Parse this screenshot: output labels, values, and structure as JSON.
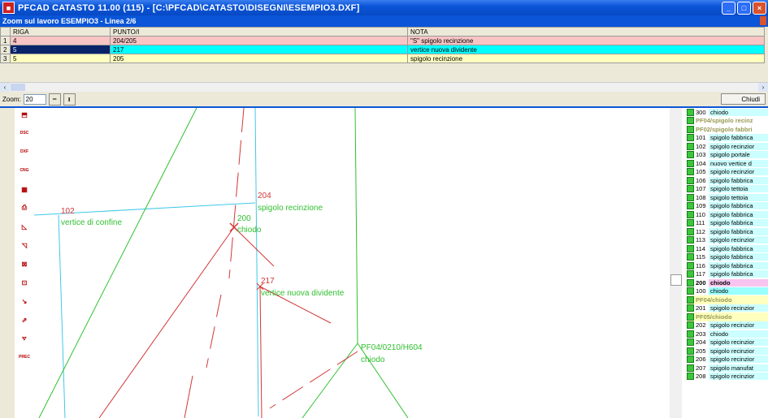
{
  "window": {
    "title": "PFCAD CATASTO 11.00 (115) - [C:\\PFCAD\\CATASTO\\DISEGNI\\ESEMPIO3.DXF]",
    "app_icon": "pfcad-icon",
    "controls": {
      "minimize": "_",
      "maximize": "□",
      "close": "×"
    }
  },
  "zoom_panel": {
    "title": "Zoom sul lavoro ESEMPIO3 - Linea 2/6",
    "columns": [
      "RIGA",
      "PUNTO/I",
      "NOTA"
    ],
    "rows": [
      {
        "num": "1",
        "riga": "4",
        "punto": "204/205",
        "nota": "\"S\" spigolo recinzione",
        "color": "#f8c4c4"
      },
      {
        "num": "2",
        "riga": "5",
        "punto": "217",
        "nota": "vertice nuova dividente",
        "color": "#00ffff"
      },
      {
        "num": "3",
        "riga": "5",
        "punto": "205",
        "nota": "spigolo recinzione",
        "color": "#ffffc0"
      }
    ],
    "zoom_label": "Zoom:",
    "zoom_value": "20",
    "minus_label": "−",
    "plus_label": "ı",
    "close_label": "Chiudi"
  },
  "toolbar": {
    "tools": [
      {
        "name": "tool-icon-1",
        "glyph": "⬒"
      },
      {
        "name": "tool-icon-dsc",
        "glyph": "DSC"
      },
      {
        "name": "tool-icon-dxf",
        "glyph": "DXF"
      },
      {
        "name": "tool-icon-cng",
        "glyph": "CNG"
      },
      {
        "name": "tool-icon-grid",
        "glyph": "▦"
      },
      {
        "name": "tool-icon-print",
        "glyph": "⎙"
      },
      {
        "name": "tool-icon-measure",
        "glyph": "◺"
      },
      {
        "name": "tool-icon-polygon",
        "glyph": "◹"
      },
      {
        "name": "tool-icon-grid2",
        "glyph": "⊠"
      },
      {
        "name": "tool-icon-cross",
        "glyph": "⊡"
      },
      {
        "name": "tool-icon-line",
        "glyph": "↘"
      },
      {
        "name": "tool-icon-arrow",
        "glyph": "⇗"
      },
      {
        "name": "tool-icon-chart",
        "glyph": "⦡"
      },
      {
        "name": "tool-icon-prec",
        "glyph": "PREC"
      }
    ]
  },
  "canvas": {
    "labels": {
      "p204_num": "204",
      "p204_desc": "spigolo recinzione",
      "p102_num": "102",
      "p102_desc": "vertice di confine",
      "p200_num": "200",
      "p200_desc": "chiodo",
      "p217_num": "217",
      "p217_desc": "vertice nuova dividente",
      "pf04_num": "PF04/0210/H604",
      "pf04_desc": "chiodo"
    },
    "colors": {
      "red": "#d23838",
      "green": "#30c030",
      "cyan": "#40c8e8"
    }
  },
  "point_list": {
    "items": [
      {
        "type": "pt",
        "code": "300",
        "desc": "chiodo",
        "style": ""
      },
      {
        "type": "hdr",
        "code": "PF04/",
        "desc": "spigolo recinz",
        "style": ""
      },
      {
        "type": "hdr",
        "code": "PF02/",
        "desc": "spigolo fabbri",
        "style": ""
      },
      {
        "type": "pt",
        "code": "101",
        "desc": "spigolo fabbrica",
        "style": ""
      },
      {
        "type": "pt",
        "code": "102",
        "desc": "spigolo recinzior",
        "style": ""
      },
      {
        "type": "pt",
        "code": "103",
        "desc": "spigolo portale",
        "style": ""
      },
      {
        "type": "pt",
        "code": "104",
        "desc": "nuovo vertice d",
        "style": ""
      },
      {
        "type": "pt",
        "code": "105",
        "desc": "spigolo recinzior",
        "style": ""
      },
      {
        "type": "pt",
        "code": "106",
        "desc": "spigolo fabbrica",
        "style": ""
      },
      {
        "type": "pt",
        "code": "107",
        "desc": "spigolo tettoia",
        "style": ""
      },
      {
        "type": "pt",
        "code": "108",
        "desc": "spigolo tettoia",
        "style": ""
      },
      {
        "type": "pt",
        "code": "109",
        "desc": "spigolo fabbrica",
        "style": ""
      },
      {
        "type": "pt",
        "code": "110",
        "desc": "spigolo fabbrica",
        "style": ""
      },
      {
        "type": "pt",
        "code": "111",
        "desc": "spigolo fabbrica",
        "style": ""
      },
      {
        "type": "pt",
        "code": "112",
        "desc": "spigolo fabbrica",
        "style": ""
      },
      {
        "type": "pt",
        "code": "113",
        "desc": "spigolo recinzior",
        "style": ""
      },
      {
        "type": "pt",
        "code": "114",
        "desc": "spigolo fabbrica",
        "style": ""
      },
      {
        "type": "pt",
        "code": "115",
        "desc": "spigolo fabbrica",
        "style": ""
      },
      {
        "type": "pt",
        "code": "116",
        "desc": "spigolo fabbrica",
        "style": ""
      },
      {
        "type": "pt",
        "code": "117",
        "desc": "spigolo fabbrica",
        "style": ""
      },
      {
        "type": "pt",
        "code": "200",
        "desc": "chiodo",
        "style": "bold pink"
      },
      {
        "type": "pt",
        "code": "100",
        "desc": "chiodo",
        "style": "cyan"
      },
      {
        "type": "hdr",
        "code": "PF04/",
        "desc": "chiodo",
        "style": "yellow"
      },
      {
        "type": "pt",
        "code": "201",
        "desc": "spigolo recinzior",
        "style": ""
      },
      {
        "type": "hdr",
        "code": "PF05/",
        "desc": "chiodo",
        "style": "yellow"
      },
      {
        "type": "pt",
        "code": "202",
        "desc": "spigolo recinzior",
        "style": ""
      },
      {
        "type": "pt",
        "code": "203",
        "desc": "chiodo",
        "style": ""
      },
      {
        "type": "pt",
        "code": "204",
        "desc": "spigolo recinzior",
        "style": ""
      },
      {
        "type": "pt",
        "code": "205",
        "desc": "spigolo recinzior",
        "style": ""
      },
      {
        "type": "pt",
        "code": "206",
        "desc": "spigolo recinzior",
        "style": ""
      },
      {
        "type": "pt",
        "code": "207",
        "desc": "spigolo manufat",
        "style": ""
      },
      {
        "type": "pt",
        "code": "208",
        "desc": "spigolo recinzior",
        "style": ""
      }
    ]
  }
}
